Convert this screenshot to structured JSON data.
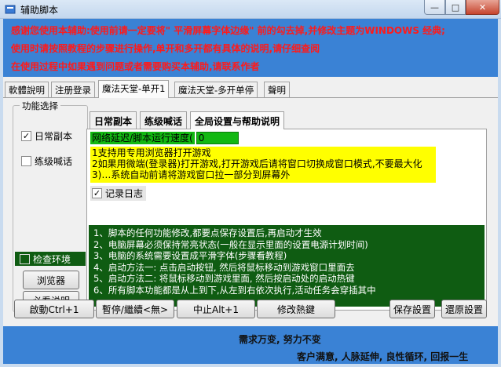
{
  "window": {
    "title": "辅助脚本",
    "min_glyph": "—",
    "max_glyph": "□",
    "close_glyph": "✕"
  },
  "banner": {
    "line1": "感谢您使用本辅助:使用前请一定要将\" 平滑屏幕字体边缘\" 前的勾去掉,并修改主题为WINDOWS 经典;",
    "line2": "使用时请按照教程的步骤进行操作,单开和多开都有具体的说明,请仔细查阅",
    "line3": "在使用过程中如果遇到问题或者需要购买本辅助,请联系作者"
  },
  "tabs": [
    "軟體說明",
    "注册登录",
    "魔法天堂-单开1",
    "魔法天堂-多开单停",
    "聲明"
  ],
  "active_tab_index": 2,
  "sidebar": {
    "legend": "功能选择",
    "daily_label": "日常副本",
    "daily_checked": true,
    "practice_label": "练级喊话",
    "practice_checked": false,
    "env_label": "检查环境",
    "env_checked": false,
    "browser_button": "浏览器",
    "readme_button": "必看说明"
  },
  "inner_tabs": [
    "日常副本",
    "练级喊话",
    "全局设置与帮助说明"
  ],
  "inner_active_index": 2,
  "settings": {
    "delay_label": "网络延迟/脚本运行速度(",
    "delay_value": "0",
    "yellow_text": "1支持用专用浏览器打开游戏\n2如果用微端(登录器)打开游戏,打开游戏后请将窗口切换成窗口模式,不要最大化\n3)…系统自动前请将游戏窗口拉一部分到屏幕外",
    "log_label": "记录日志",
    "log_checked": true,
    "notes": [
      "1、脚本的任何功能修改,都要点保存设置后,再启动才生效",
      "2、电脑屏幕必须保持常亮状态(一般在显示里面的设置电源计划时间)",
      "3、电脑的系统需要设置成平滑字体(步骤看教程)",
      "4、启动方法一: 点击启动按钮, 然后将鼠标移动到游戏窗口里面去",
      "5、启动方法二: 将鼠标移动到游戏里面, 然后按启动处的启动热键",
      "6、所有脚本功能都是从上到下,从左到右依次执行,活动任务会穿插其中"
    ]
  },
  "buttons": {
    "start": "啟動Ctrl+1",
    "pause": "暫停/繼續<無>",
    "stop": "中止Alt+1",
    "hotkey": "修改熱鍵",
    "save": "保存設置",
    "restore": "還原設置"
  },
  "footer": {
    "line1": "需求万变, 努力不变",
    "line2": "客户满意, 人脉延伸, 良性循环, 回报一生"
  },
  "colors": {
    "banner": "#3a82d5",
    "banner_text": "#ff1a1a",
    "notes_bg": "#0f5c12",
    "delay_bg": "#12b812",
    "help_bg": "#ffff00"
  }
}
